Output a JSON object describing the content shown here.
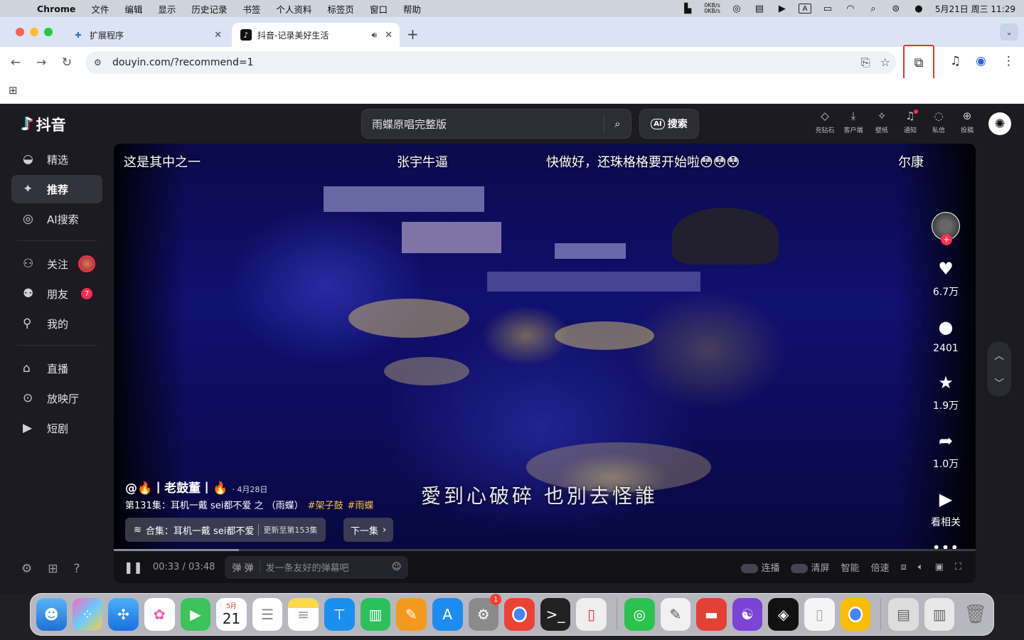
{
  "menubar": {
    "app_name": "Chrome",
    "items": [
      "文件",
      "编辑",
      "显示",
      "历史记录",
      "书签",
      "个人资料",
      "标签页",
      "窗口",
      "帮助"
    ],
    "net_up": "0KB/s",
    "net_down": "0KB/s",
    "input_method": "A",
    "datetime": "5月21日 周三 11:29"
  },
  "tabs": [
    {
      "title": "扩展程序",
      "icon": "puzzle-icon"
    },
    {
      "title": "抖音-记录美好生活",
      "icon": "douyin-icon",
      "active": true
    }
  ],
  "toolbar": {
    "url": "douyin.com/?recommend=1"
  },
  "douyin": {
    "logo_text": "抖音",
    "search_value": "雨蝶原唱完整版",
    "ai_search_badge": "AI",
    "ai_search_label": "搜索",
    "top_actions": [
      "充钻石",
      "客户端",
      "壁纸",
      "通知",
      "私信",
      "投稿"
    ],
    "sidebar": [
      {
        "label": "精选",
        "icon": "featured-icon"
      },
      {
        "label": "推荐",
        "icon": "sparkle-icon",
        "active": true
      },
      {
        "label": "AI搜索",
        "icon": "ai-search-icon"
      },
      {
        "label": "关注",
        "icon": "follow-icon"
      },
      {
        "label": "朋友",
        "icon": "friends-icon",
        "badge": "7"
      },
      {
        "label": "我的",
        "icon": "profile-icon"
      },
      {
        "label": "直播",
        "icon": "live-icon"
      },
      {
        "label": "放映厅",
        "icon": "cinema-icon"
      },
      {
        "label": "短剧",
        "icon": "short-drama-icon"
      }
    ],
    "video": {
      "danmu": [
        "这是其中之一",
        "张宇牛逼",
        "快做好，还珠格格要开始啦😳😳😳",
        "尔康"
      ],
      "lyric": "愛到心破碎 也別去怪誰",
      "author": "@🔥丨老鼓董丨🔥",
      "date": "· 4月28日",
      "description": "第131集：耳机一戴 sei都不爱 之 （雨蝶）",
      "tags": [
        "#架子鼓",
        "#雨蝶"
      ],
      "collection": "合集：耳机一戴 sei都不爱",
      "collection_update": "更新至第153集",
      "next_episode": "下一集",
      "likes": "6.7万",
      "comments": "2401",
      "favorites": "1.9万",
      "shares": "1.0万",
      "related": "看相关",
      "time_current": "00:33",
      "time_total": "03:48",
      "progress": 0.145,
      "danmu_placeholder": "发一条友好的弹幕吧",
      "controls": [
        "连播",
        "清屏",
        "智能",
        "倍速"
      ]
    }
  },
  "dock": {
    "settings_badge": "1",
    "calendar_month": "5月",
    "calendar_day": "21"
  }
}
